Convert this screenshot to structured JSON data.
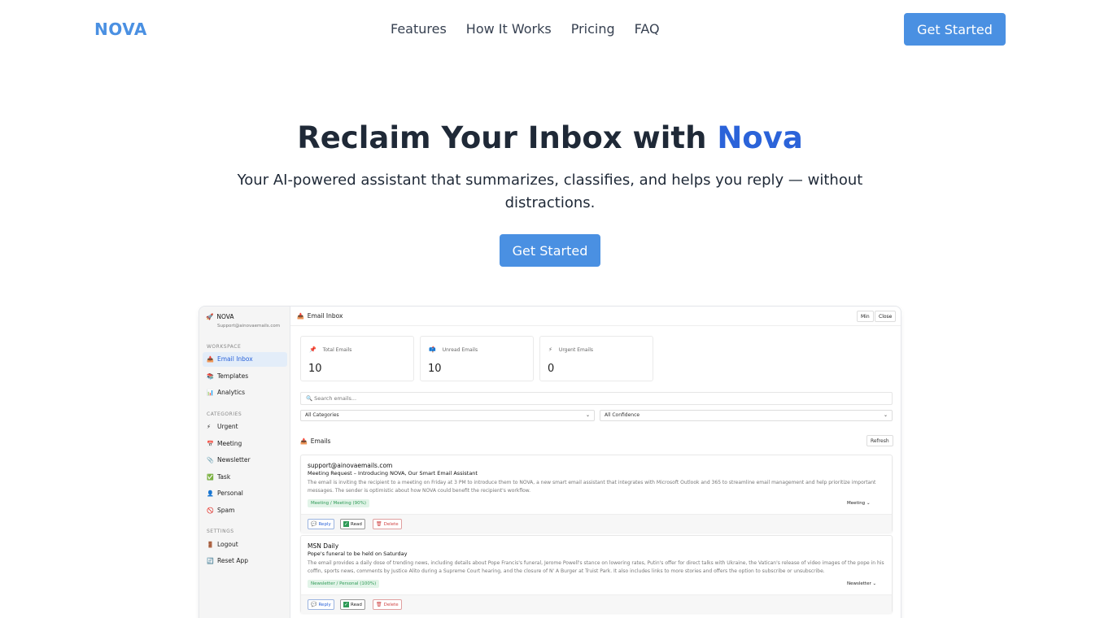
{
  "nav": {
    "logo": "NOVA",
    "links": [
      "Features",
      "How It Works",
      "Pricing",
      "FAQ"
    ],
    "cta": "Get Started"
  },
  "hero": {
    "title_main": "Reclaim Your Inbox with ",
    "title_accent": "Nova",
    "subtitle": "Your AI-powered assistant that summarizes, classifies, and helps you reply — without distractions.",
    "cta": "Get Started"
  },
  "app": {
    "sidebar": {
      "brand": "NOVA",
      "email": "Support@ainovaemails.com",
      "workspace_label": "WORKSPACE",
      "workspace_items": [
        {
          "icon": "inbox-icon",
          "glyph": "📥",
          "label": "Email Inbox"
        },
        {
          "icon": "books-icon",
          "glyph": "📚",
          "label": "Templates"
        },
        {
          "icon": "chart-icon",
          "glyph": "📊",
          "label": "Analytics"
        }
      ],
      "categories_label": "CATEGORIES",
      "category_items": [
        {
          "icon": "lightning-icon",
          "glyph": "⚡",
          "label": "Urgent"
        },
        {
          "icon": "calendar-icon",
          "glyph": "📅",
          "label": "Meeting"
        },
        {
          "icon": "newspaper-icon",
          "glyph": "📎",
          "label": "Newsletter"
        },
        {
          "icon": "checkmark-icon",
          "glyph": "✅",
          "label": "Task"
        },
        {
          "icon": "person-icon",
          "glyph": "👤",
          "label": "Personal"
        },
        {
          "icon": "no-entry-icon",
          "glyph": "🚫",
          "label": "Spam"
        }
      ],
      "settings_label": "SETTINGS",
      "settings_items": [
        {
          "icon": "door-icon",
          "glyph": "🚪",
          "label": "Logout"
        },
        {
          "icon": "refresh-icon",
          "glyph": "🔄",
          "label": "Reset App"
        }
      ]
    },
    "topbar": {
      "title": "Email Inbox",
      "min_label": "Min",
      "close_label": "Close"
    },
    "stats": [
      {
        "icon": "pin-icon",
        "glyph": "📌",
        "label": "Total Emails",
        "value": "10"
      },
      {
        "icon": "mailbox-icon",
        "glyph": "📫",
        "label": "Unread Emails",
        "value": "10"
      },
      {
        "icon": "lightning-icon",
        "glyph": "⚡",
        "label": "Urgent Emails",
        "value": "0"
      }
    ],
    "search_placeholder": "🔍 Search emails...",
    "filters": {
      "category": "All Categories",
      "confidence": "All Confidence"
    },
    "emails_heading": "Emails",
    "refresh_label": "Refresh",
    "emails": [
      {
        "from": "support@ainovaemails.com",
        "subject": "Meeting Request – Introducing NOVA, Our Smart Email Assistant",
        "summary": "The email is inviting the recipient to a meeting on Friday at 3 PM to introduce them to NOVA, a new smart email assistant that integrates with Microsoft Outlook and 365 to streamline email management and help prioritize important messages. The sender is optimistic about how NOVA could benefit the recipient's workflow.",
        "tag": "Meeting / Meeting (90%)",
        "category": "Meeting",
        "reply": "Reply",
        "read": "Read",
        "delete": "Delete"
      },
      {
        "from": "MSN Daily",
        "subject": "Pope's funeral to be held on Saturday",
        "summary": "The email provides a daily dose of trending news, including details about Pope Francis's funeral, Jerome Powell's stance on lowering rates, Putin's offer for direct talks with Ukraine, the Vatican's release of video images of the pope in his coffin, sports news, comments by Justice Alito during a Supreme Court hearing, and the closure of N' A Burger at Truist Park. It also includes links to more stories and offers the option to subscribe or unsubscribe.",
        "tag": "Newsletter / Personal (100%)",
        "category": "Newsletter",
        "reply": "Reply",
        "read": "Read",
        "delete": "Delete"
      }
    ]
  },
  "colors": {
    "brand": "#4a90e2",
    "accent": "#2b63d9",
    "tag_bg": "#e2f4e8",
    "tag_text": "#2e9a57"
  }
}
